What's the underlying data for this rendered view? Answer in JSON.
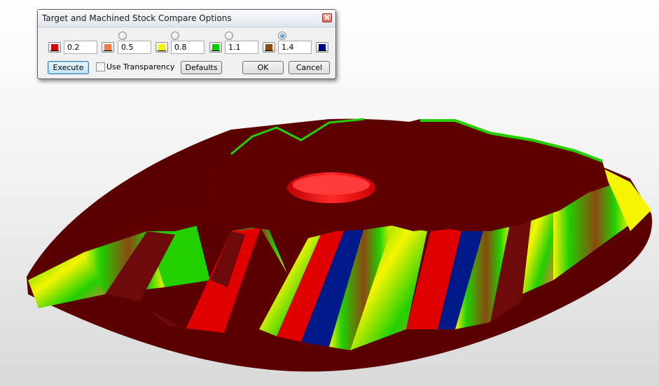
{
  "dialog": {
    "title": "Target and Machined Stock Compare Options",
    "thresholds": [
      "0.2",
      "0.5",
      "0.8",
      "1.1",
      "1.4"
    ],
    "swatch_colors": [
      "#e00000",
      "#f07840",
      "#f5f500",
      "#00d000",
      "#8b4a10",
      "#000090"
    ],
    "selected_radio_index": 3,
    "execute_label": "Execute",
    "use_transparency_label": "Use Transparency",
    "use_transparency_checked": false,
    "defaults_label": "Defaults",
    "ok_label": "OK",
    "cancel_label": "Cancel"
  },
  "viewport": {
    "model": "gear-stock-comparison",
    "colors": {
      "stock": "#5a0000",
      "rim": "#6e0a0a",
      "bore": "#ff1a1a",
      "red": "#e00000",
      "orange": "#f07840",
      "yellow": "#f5f500",
      "green": "#22d000",
      "brown": "#8b4a10",
      "blue": "#001a8c"
    }
  }
}
